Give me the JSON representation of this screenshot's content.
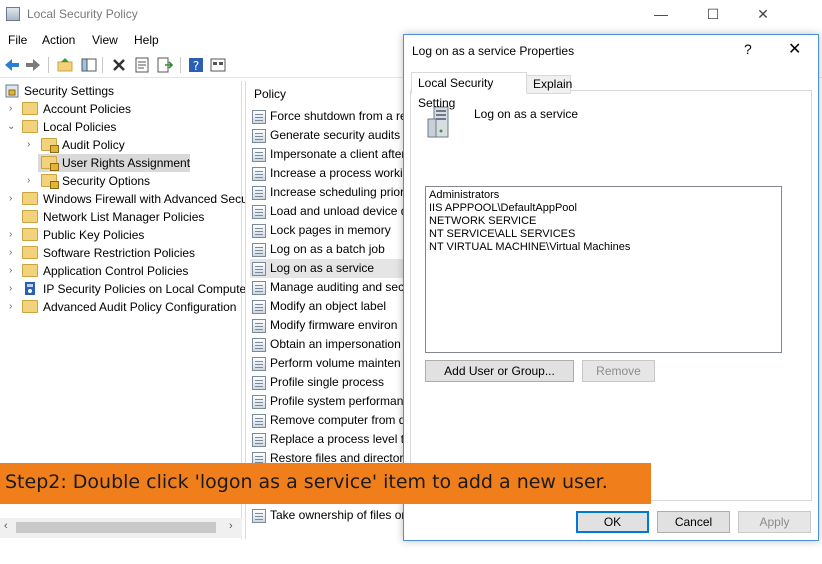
{
  "window": {
    "title": "Local Security Policy",
    "controls": [
      "—",
      "☐",
      "✕"
    ]
  },
  "menu": [
    "File",
    "Action",
    "View",
    "Help"
  ],
  "tree": [
    {
      "label": "Security Settings",
      "level": 0,
      "arrow": "⌄"
    },
    {
      "label": "Account Policies",
      "level": 1,
      "arrow": "›"
    },
    {
      "label": "Local Policies",
      "level": 1,
      "arrow": "⌄"
    },
    {
      "label": "Audit Policy",
      "level": 2,
      "arrow": "›"
    },
    {
      "label": "User Rights Assignment",
      "level": 2,
      "arrow": "",
      "selected": true
    },
    {
      "label": "Security Options",
      "level": 2,
      "arrow": "›"
    },
    {
      "label": "Windows Firewall with Advanced Secu",
      "level": 1,
      "arrow": "›"
    },
    {
      "label": "Network List Manager Policies",
      "level": 1,
      "arrow": ""
    },
    {
      "label": "Public Key Policies",
      "level": 1,
      "arrow": "›"
    },
    {
      "label": "Software Restriction Policies",
      "level": 1,
      "arrow": "›"
    },
    {
      "label": "Application Control Policies",
      "level": 1,
      "arrow": "›"
    },
    {
      "label": "IP Security Policies on Local Compute",
      "level": 1,
      "arrow": "›"
    },
    {
      "label": "Advanced Audit Policy Configuration",
      "level": 1,
      "arrow": "›"
    }
  ],
  "policy_pane": {
    "header": "Policy",
    "items": [
      "Force shutdown from a re",
      "Generate security audits",
      "Impersonate a client after",
      "Increase a process workin",
      "Increase scheduling prior",
      "Load and unload device d",
      "Lock pages in memory",
      "Log on as a batch job",
      "Log on as a service",
      "Manage auditing and sec",
      "Modify an object label",
      "Modify firmware environ",
      "Obtain an impersonation",
      "Perform volume mainten",
      "Profile single process",
      "Profile system performan",
      "Remove computer from d",
      "Replace a process level to",
      "Restore files and directori"
    ],
    "last_item": "Take ownership of files or",
    "selected_index": 8
  },
  "dialog": {
    "title": "Log on as a service Properties",
    "help": "?",
    "close": "✕",
    "tabs": {
      "active": "Local Security Setting",
      "inactive": "Explain"
    },
    "policy_name": "Log on as a service",
    "members": [
      "Administrators",
      "IIS APPPOOL\\DefaultAppPool",
      "NETWORK SERVICE",
      "NT SERVICE\\ALL SERVICES",
      "NT VIRTUAL MACHINE\\Virtual Machines"
    ],
    "add_button": "Add User or Group...",
    "remove_button": "Remove",
    "ok_button": "OK",
    "cancel_button": "Cancel",
    "apply_button": "Apply"
  },
  "banner": {
    "text": "Step2: Double click 'logon as a service' item to add a new user."
  },
  "colors": {
    "banner_bg": "#f07f1b",
    "dialog_border": "#4a90d9",
    "default_button_border": "#0078d7"
  }
}
